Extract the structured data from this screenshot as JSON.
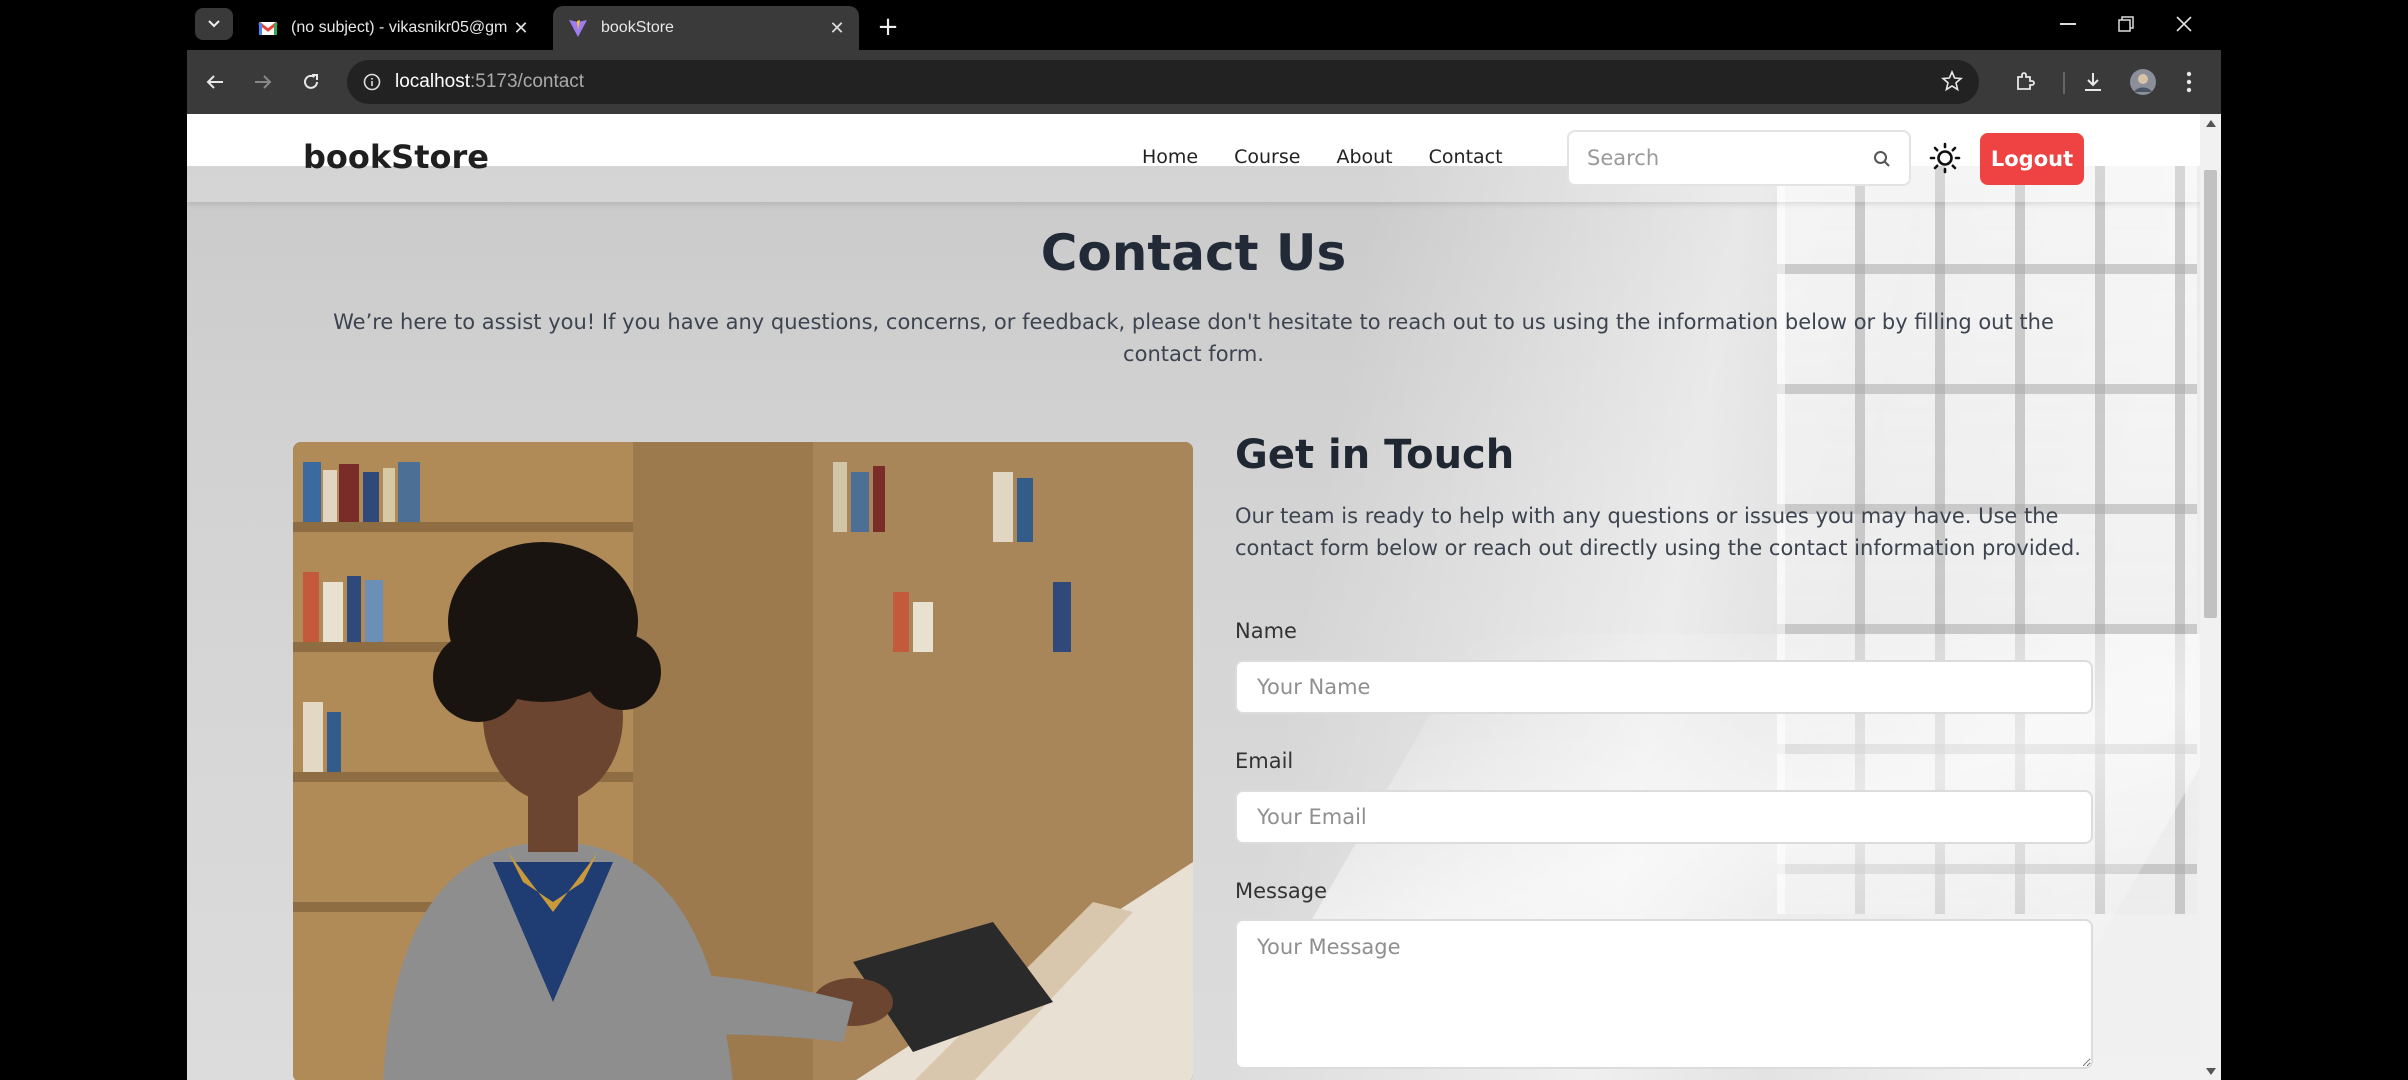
{
  "browser": {
    "tabs": [
      {
        "title": "(no subject) - vikasnikr05@gmai",
        "favicon": "gmail-icon",
        "active": false
      },
      {
        "title": "bookStore",
        "favicon": "vite-icon",
        "active": true
      }
    ],
    "address": {
      "host": "localhost",
      "path": ":5173/contact"
    }
  },
  "site": {
    "brand": "bookStore",
    "nav": {
      "home": "Home",
      "course": "Course",
      "about": "About",
      "contact": "Contact"
    },
    "search_placeholder": "Search",
    "logout": "Logout",
    "colors": {
      "logout": "#ef4343",
      "title": "#222a38"
    }
  },
  "contact": {
    "title": "Contact Us",
    "intro": "We’re here to assist you! If you have any questions, concerns, or feedback, please don't hesitate to reach out to us using the information below or by filling out the contact form.",
    "get_in_touch": {
      "title": "Get in Touch",
      "description": "Our team is ready to help with any questions or issues you may have. Use the contact form below or reach out directly using the contact information provided."
    },
    "form": {
      "name_label": "Name",
      "name_placeholder": "Your Name",
      "email_label": "Email",
      "email_placeholder": "Your Email",
      "message_label": "Message",
      "message_placeholder": "Your Message"
    }
  }
}
